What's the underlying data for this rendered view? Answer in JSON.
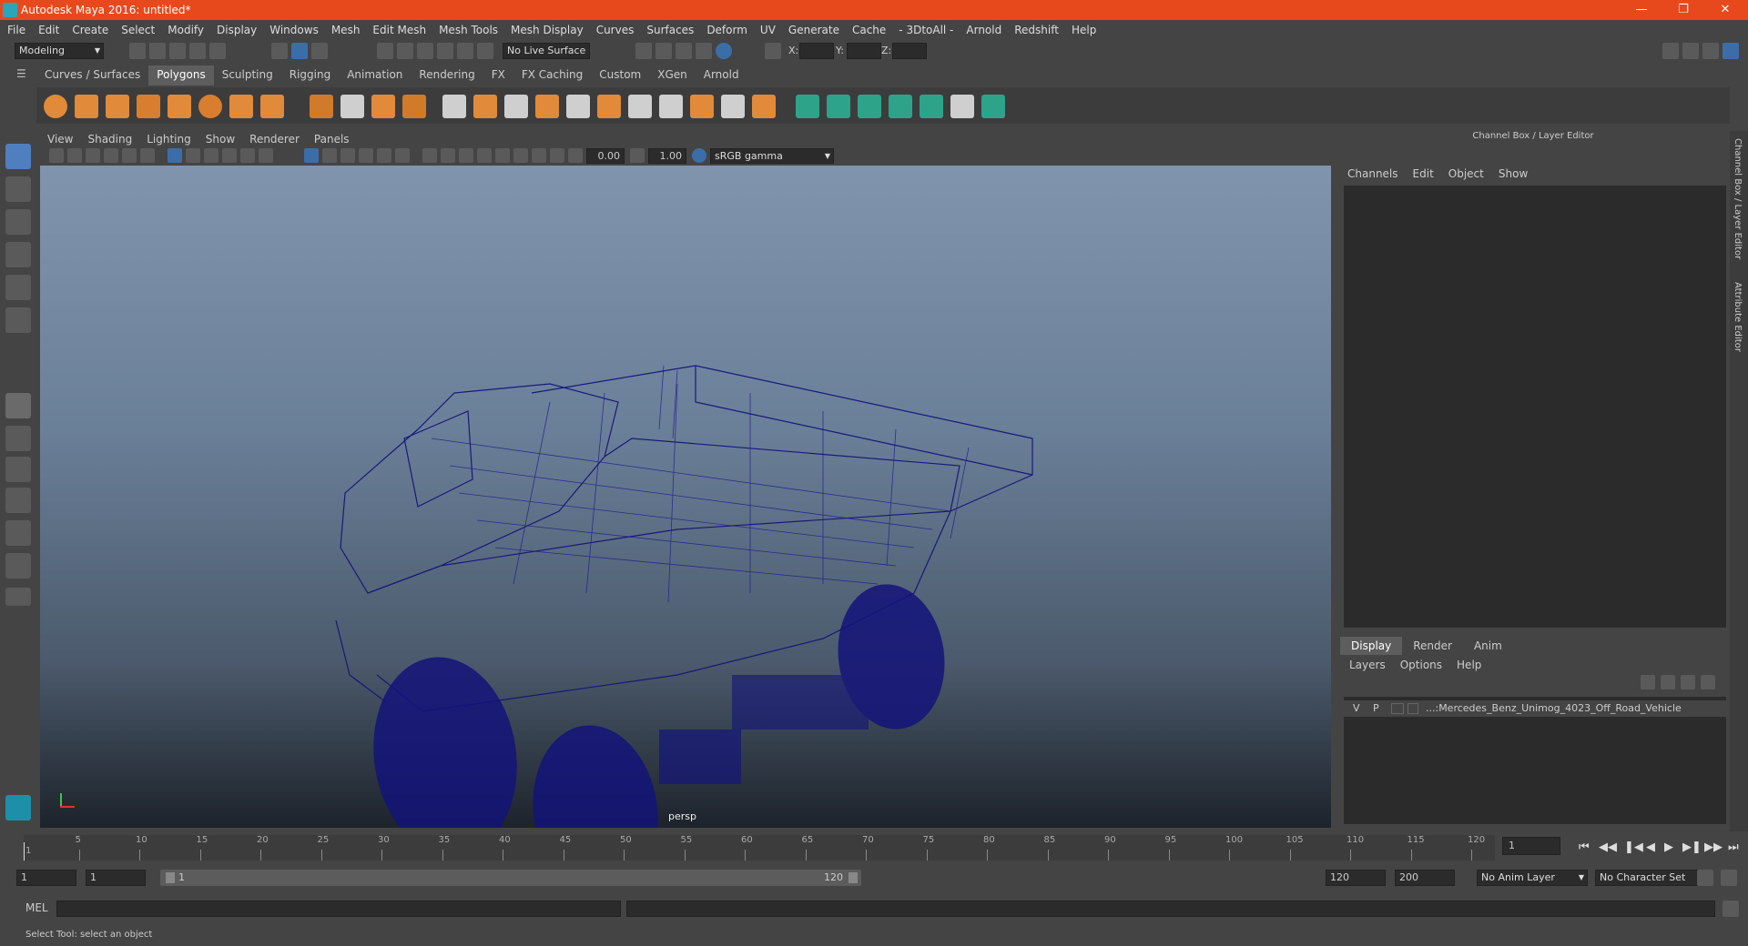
{
  "window": {
    "title": "Autodesk Maya 2016: untitled*"
  },
  "menubar": [
    "File",
    "Edit",
    "Create",
    "Select",
    "Modify",
    "Display",
    "Windows",
    "Mesh",
    "Edit Mesh",
    "Mesh Tools",
    "Mesh Display",
    "Curves",
    "Surfaces",
    "Deform",
    "UV",
    "Generate",
    "Cache",
    "- 3DtoAll -",
    "Arnold",
    "Redshift",
    "Help"
  ],
  "statusline": {
    "mode": "Modeling",
    "live_surface": "No Live Surface",
    "x_label": "X:",
    "y_label": "Y:",
    "z_label": "Z:"
  },
  "shelf_tabs": [
    "Curves / Surfaces",
    "Polygons",
    "Sculpting",
    "Rigging",
    "Animation",
    "Rendering",
    "FX",
    "FX Caching",
    "Custom",
    "XGen",
    "Arnold"
  ],
  "viewport": {
    "menu": [
      "View",
      "Shading",
      "Lighting",
      "Show",
      "Renderer",
      "Panels"
    ],
    "exposure": "0.00",
    "gamma": "1.00",
    "color_space": "sRGB gamma",
    "camera": "persp"
  },
  "channel_box": {
    "title": "Channel Box / Layer Editor",
    "menu": [
      "Channels",
      "Edit",
      "Object",
      "Show"
    ],
    "side_tab_1": "Channel Box / Layer Editor",
    "side_tab_2": "Attribute Editor"
  },
  "layer_editor": {
    "tabs": [
      "Display",
      "Render",
      "Anim"
    ],
    "menu": [
      "Layers",
      "Options",
      "Help"
    ],
    "row": {
      "v": "V",
      "p": "P",
      "name": "...:Mercedes_Benz_Unimog_4023_Off_Road_Vehicle"
    }
  },
  "timeline": {
    "ticks": [
      "5",
      "10",
      "15",
      "20",
      "25",
      "30",
      "35",
      "40",
      "45",
      "50",
      "55",
      "60",
      "65",
      "70",
      "75",
      "80",
      "85",
      "90",
      "95",
      "100",
      "105",
      "110",
      "115",
      "120"
    ],
    "current_frame_marker": "1",
    "current_frame_field": "1"
  },
  "range": {
    "start_field": "1",
    "playback_start": "1",
    "slider_start": "1",
    "slider_end": "120",
    "playback_end": "120",
    "end_field": "200",
    "anim_layer": "No Anim Layer",
    "character_set": "No Character Set"
  },
  "command": {
    "lang": "MEL"
  },
  "help_line": "Select Tool: select an object",
  "colors": {
    "title_bar": "#e8491c",
    "active_tab": "#5d5d5d",
    "wireframe": "#141478"
  }
}
